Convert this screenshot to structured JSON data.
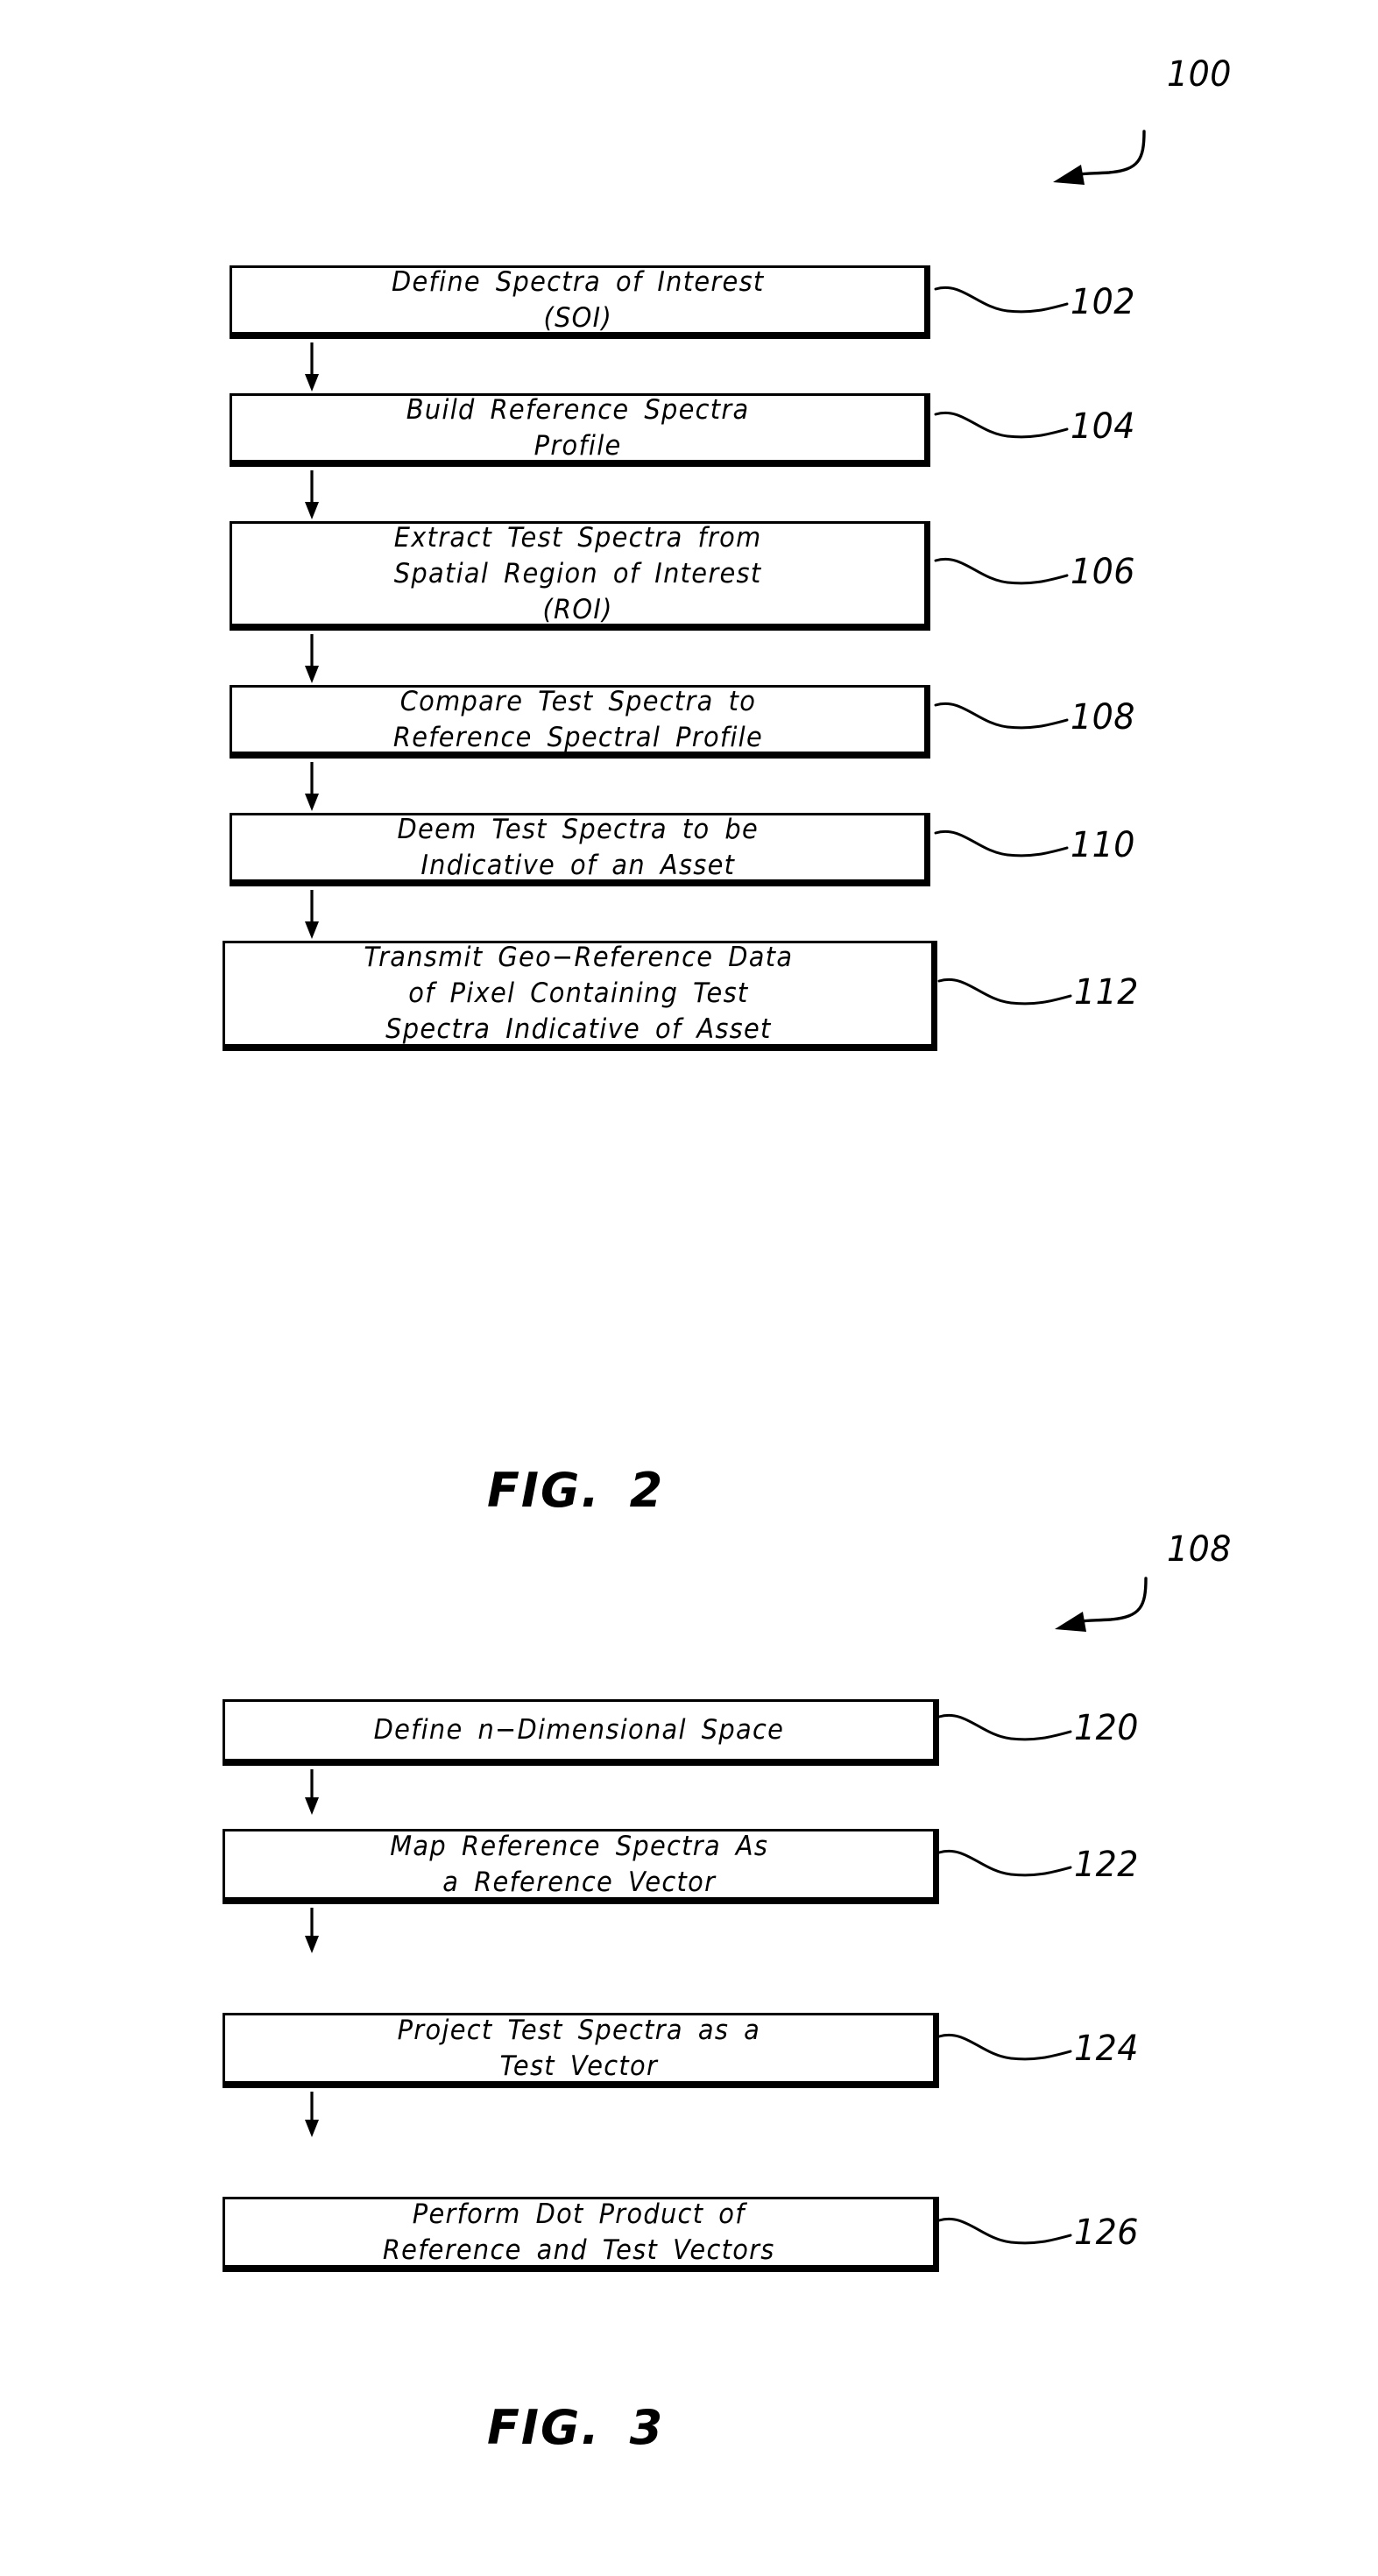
{
  "document": {
    "type": "patent-drawing-sheet",
    "figures": [
      {
        "id": "fig2",
        "caption": "FIG. 2",
        "reference_numeral": "100",
        "steps": [
          {
            "ref": "102",
            "text": "Define Spectra of Interest\n(SOI)"
          },
          {
            "ref": "104",
            "text": "Build Reference Spectra\nProfile"
          },
          {
            "ref": "106",
            "text": "Extract Test Spectra from\nSpatial Region of Interest\n(ROI)"
          },
          {
            "ref": "108",
            "text": "Compare Test Spectra to\nReference Spectral Profile"
          },
          {
            "ref": "110",
            "text": "Deem Test Spectra to be\nIndicative of an Asset"
          },
          {
            "ref": "112",
            "text": "Transmit Geo−Reference Data\nof Pixel Containing Test\nSpectra Indicative of Asset"
          }
        ]
      },
      {
        "id": "fig3",
        "caption": "FIG. 3",
        "reference_numeral": "108",
        "steps": [
          {
            "ref": "120",
            "text": "Define n−Dimensional Space"
          },
          {
            "ref": "122",
            "text": "Map Reference Spectra As\na Reference Vector"
          },
          {
            "ref": "124",
            "text": "Project Test Spectra as a\nTest Vector"
          },
          {
            "ref": "126",
            "text": "Perform Dot Product of\nReference and Test Vectors"
          }
        ]
      }
    ],
    "colors": {
      "ink": "#000000",
      "paper": "#ffffff"
    }
  }
}
